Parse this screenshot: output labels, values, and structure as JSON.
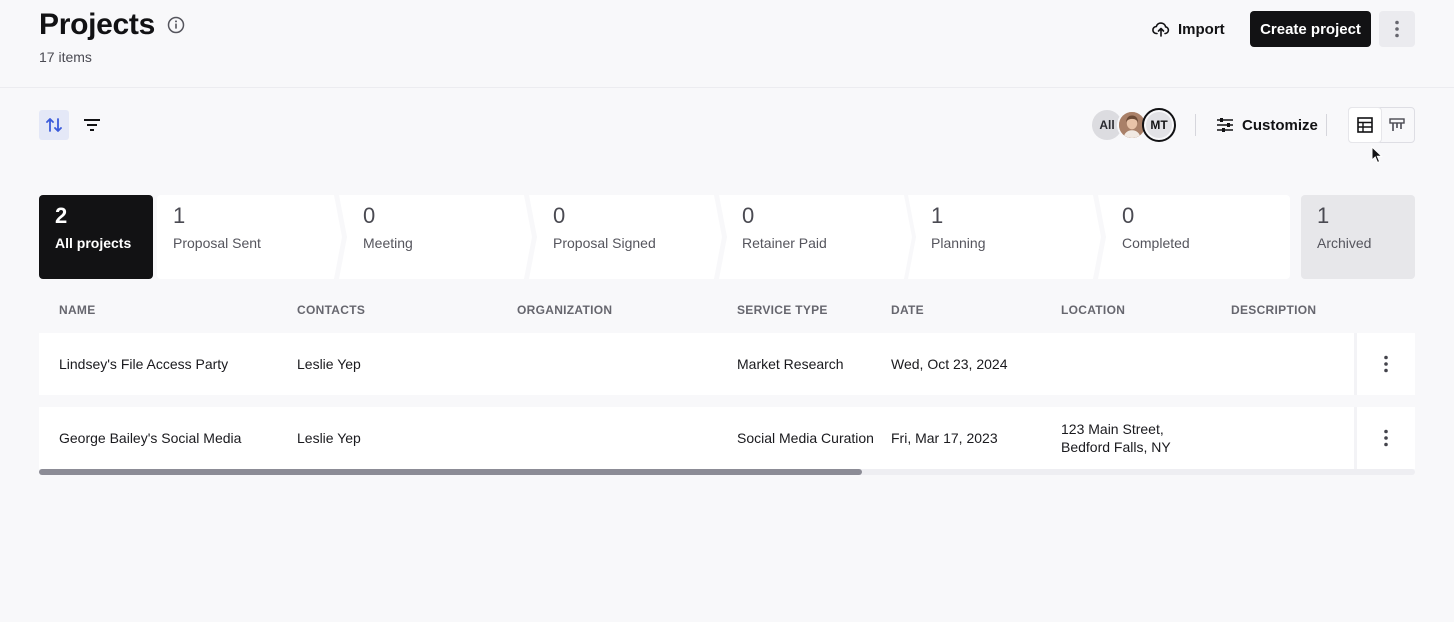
{
  "header": {
    "title": "Projects",
    "item_count": "17 items",
    "import_label": "Import",
    "create_label": "Create project"
  },
  "toolbar": {
    "avatar_all": "All",
    "avatar_mt": "MT",
    "customize_label": "Customize"
  },
  "stages": [
    {
      "count": "2",
      "label": "All projects"
    },
    {
      "count": "1",
      "label": "Proposal Sent"
    },
    {
      "count": "0",
      "label": "Meeting"
    },
    {
      "count": "0",
      "label": "Proposal Signed"
    },
    {
      "count": "0",
      "label": "Retainer Paid"
    },
    {
      "count": "1",
      "label": "Planning"
    },
    {
      "count": "0",
      "label": "Completed"
    },
    {
      "count": "1",
      "label": "Archived"
    }
  ],
  "table": {
    "columns": [
      "NAME",
      "CONTACTS",
      "ORGANIZATION",
      "SERVICE TYPE",
      "DATE",
      "LOCATION",
      "DESCRIPTION"
    ],
    "rows": [
      {
        "name": "Lindsey's File Access Party",
        "contacts": "Leslie Yep",
        "organization": "",
        "service_type": "Market Research",
        "date": "Wed, Oct 23, 2024",
        "location_line1": "",
        "location_line2": "",
        "description": ""
      },
      {
        "name": "George Bailey's Social Media",
        "contacts": "Leslie Yep",
        "organization": "",
        "service_type": "Social Media Curation",
        "date": "Fri, Mar 17, 2023",
        "location_line1": "123 Main Street,",
        "location_line2": "Bedford Falls, NY",
        "description": ""
      }
    ]
  },
  "colors": {
    "accent_dark": "#121214",
    "sort_active_bg": "#e4e8f7",
    "sort_icon": "#3b5bdb"
  }
}
